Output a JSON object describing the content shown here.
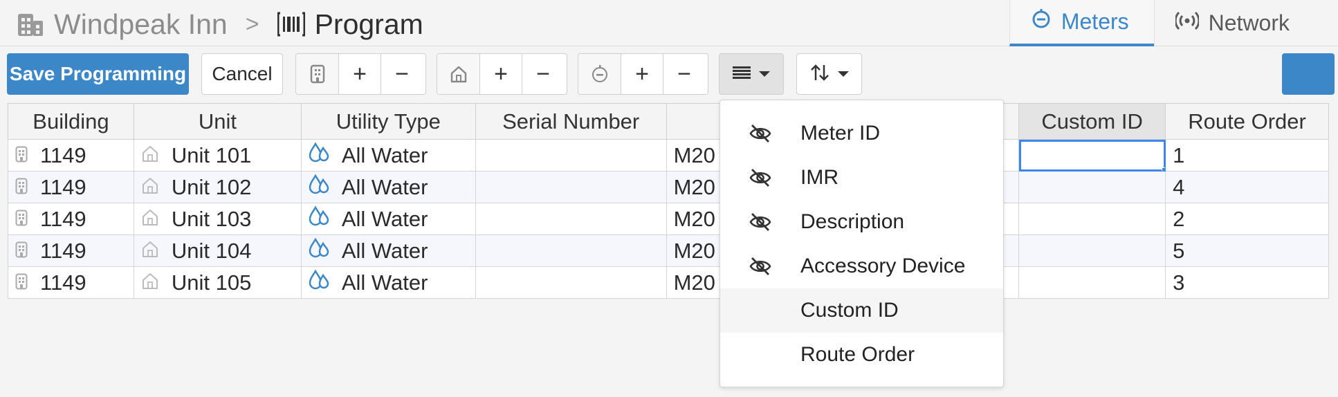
{
  "header": {
    "crumbs": [
      "Windpeak Inn",
      "Program"
    ],
    "separator": ">",
    "tabs": [
      {
        "label": "Meters",
        "active": true
      },
      {
        "label": "Network",
        "active": false
      }
    ]
  },
  "toolbar": {
    "save_label": "Save Programming",
    "cancel_label": "Cancel",
    "plus": "+",
    "minus": "−"
  },
  "table": {
    "columns": [
      "Building",
      "Unit",
      "Utility Type",
      "Serial Number",
      "",
      "",
      "",
      "Custom ID",
      "Route Order"
    ],
    "rows": [
      {
        "building": "1149",
        "unit": "Unit 101",
        "utility": "All Water",
        "serial": "",
        "meter": "M20",
        "custom_id": "",
        "route_order": "1"
      },
      {
        "building": "1149",
        "unit": "Unit 102",
        "utility": "All Water",
        "serial": "",
        "meter": "M20",
        "custom_id": "",
        "route_order": "4"
      },
      {
        "building": "1149",
        "unit": "Unit 103",
        "utility": "All Water",
        "serial": "",
        "meter": "M20",
        "custom_id": "",
        "route_order": "2"
      },
      {
        "building": "1149",
        "unit": "Unit 104",
        "utility": "All Water",
        "serial": "",
        "meter": "M20",
        "custom_id": "",
        "route_order": "5"
      },
      {
        "building": "1149",
        "unit": "Unit 105",
        "utility": "All Water",
        "serial": "",
        "meter": "M20",
        "custom_id": "",
        "route_order": "3"
      }
    ]
  },
  "column_menu": {
    "items": [
      {
        "label": "Meter ID",
        "hidden": true
      },
      {
        "label": "IMR",
        "hidden": true
      },
      {
        "label": "Description",
        "hidden": true
      },
      {
        "label": "Accessory Device",
        "hidden": true
      },
      {
        "label": "Custom ID",
        "hidden": false
      },
      {
        "label": "Route Order",
        "hidden": false
      }
    ]
  },
  "colors": {
    "accent": "#3b87c8",
    "background": "#f4f4f4",
    "water_icon": "#3b87c8"
  }
}
